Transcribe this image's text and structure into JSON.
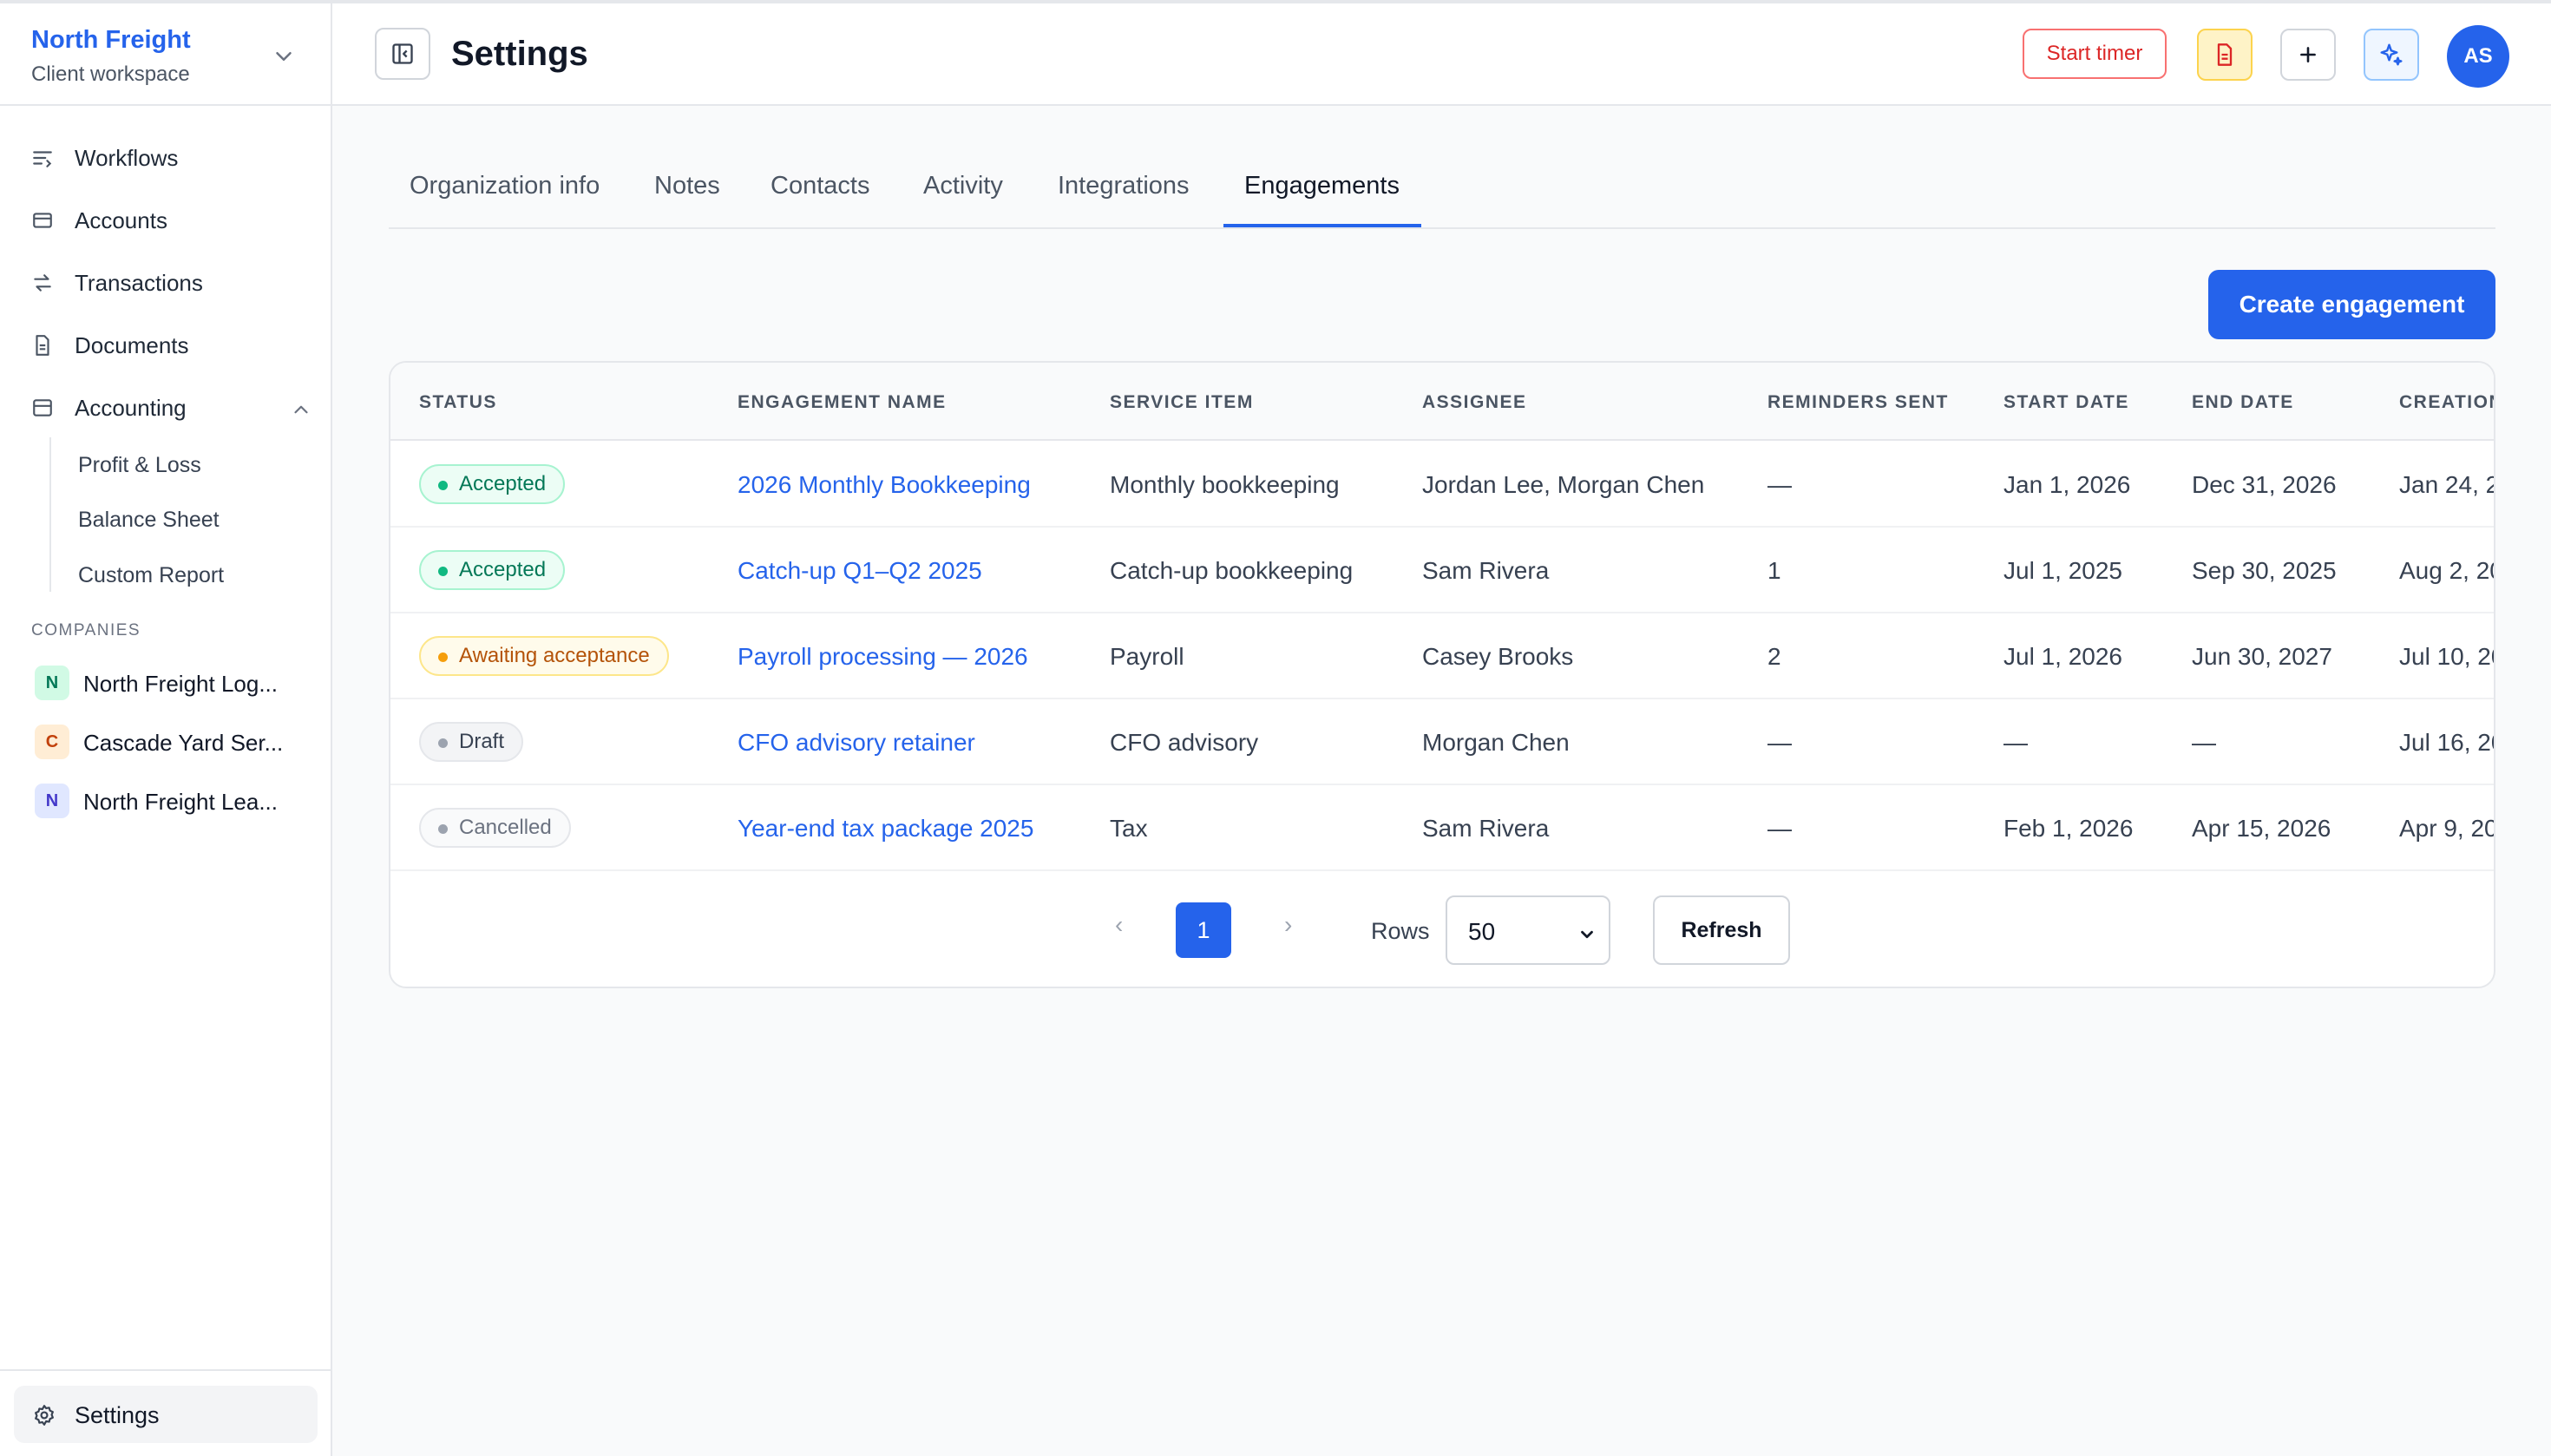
{
  "workspace": {
    "name": "North Freight",
    "subtitle": "Client workspace"
  },
  "nav": {
    "workflows": "Workflows",
    "accounts": "Accounts",
    "transactions": "Transactions",
    "documents": "Documents",
    "accounting": "Accounting",
    "accounting_children": [
      "Profit & Loss",
      "Balance Sheet",
      "Custom Report"
    ],
    "settings": "Settings"
  },
  "companies": {
    "label": "COMPANIES",
    "items": [
      {
        "initial": "N",
        "name": "North Freight Log...",
        "badge_bg": "#d1fae5",
        "badge_fg": "#047857"
      },
      {
        "initial": "C",
        "name": "Cascade Yard Ser...",
        "badge_bg": "#ffedd5",
        "badge_fg": "#c2410c"
      },
      {
        "initial": "N",
        "name": "North Freight Lea...",
        "badge_bg": "#e0e7ff",
        "badge_fg": "#4338ca"
      }
    ]
  },
  "header": {
    "title": "Settings",
    "start_timer": "Start timer",
    "avatar_initials": "AS",
    "icons": [
      "sidebar-toggle-icon",
      "document-icon",
      "plus-icon",
      "sparkle-icon"
    ]
  },
  "tabs": [
    "Organization info",
    "Notes",
    "Contacts",
    "Activity",
    "Integrations",
    "Engagements"
  ],
  "active_tab": "Engagements",
  "create_button": "Create engagement",
  "table": {
    "columns": [
      "STATUS",
      "ENGAGEMENT NAME",
      "SERVICE ITEM",
      "ASSIGNEE",
      "REMINDERS SENT",
      "START DATE",
      "END DATE",
      "CREATION"
    ],
    "rows": [
      {
        "status": "Accepted",
        "name": "2026 Monthly Bookkeeping",
        "service": "Monthly bookkeeping",
        "assignee": "Jordan Lee, Morgan Chen",
        "reminders": "—",
        "start": "Jan 1, 2026",
        "end": "Dec 31, 2026",
        "created": "Jan 24, 2"
      },
      {
        "status": "Accepted",
        "name": "Catch-up Q1–Q2 2025",
        "service": "Catch-up bookkeeping",
        "assignee": "Sam Rivera",
        "reminders": "1",
        "start": "Jul 1, 2025",
        "end": "Sep 30, 2025",
        "created": "Aug 2, 20"
      },
      {
        "status": "Awaiting acceptance",
        "name": "Payroll processing — 2026",
        "service": "Payroll",
        "assignee": "Casey Brooks",
        "reminders": "2",
        "start": "Jul 1, 2026",
        "end": "Jun 30, 2027",
        "created": "Jul 10, 20"
      },
      {
        "status": "Draft",
        "name": "CFO advisory retainer",
        "service": "CFO advisory",
        "assignee": "Morgan Chen",
        "reminders": "—",
        "start": "—",
        "end": "—",
        "created": "Jul 16, 20"
      },
      {
        "status": "Cancelled",
        "name": "Year-end tax package 2025",
        "service": "Tax",
        "assignee": "Sam Rivera",
        "reminders": "—",
        "start": "Feb 1, 2026",
        "end": "Apr 15, 2026",
        "created": "Apr 9, 20"
      }
    ]
  },
  "status_styles": {
    "Accepted": {
      "bg": "#ecfdf5",
      "border": "#a7f3d0",
      "fg": "#047857",
      "dot": "#10b981"
    },
    "Awaiting acceptance": {
      "bg": "#fffbeb",
      "border": "#fde68a",
      "fg": "#b45309",
      "dot": "#f59e0b"
    },
    "Draft": {
      "bg": "#f3f4f6",
      "border": "#e5e7eb",
      "fg": "#374151",
      "dot": "#9ca3af"
    },
    "Cancelled": {
      "bg": "#f9fafb",
      "border": "#e5e7eb",
      "fg": "#6b7280",
      "dot": "#9ca3af"
    }
  },
  "pagination": {
    "prev": "‹",
    "current_page": "1",
    "next": "›",
    "rows_label": "Rows",
    "rows_value": "50",
    "refresh": "Refresh"
  },
  "colors": {
    "accent": "#2563eb",
    "danger": "#dc2626"
  }
}
